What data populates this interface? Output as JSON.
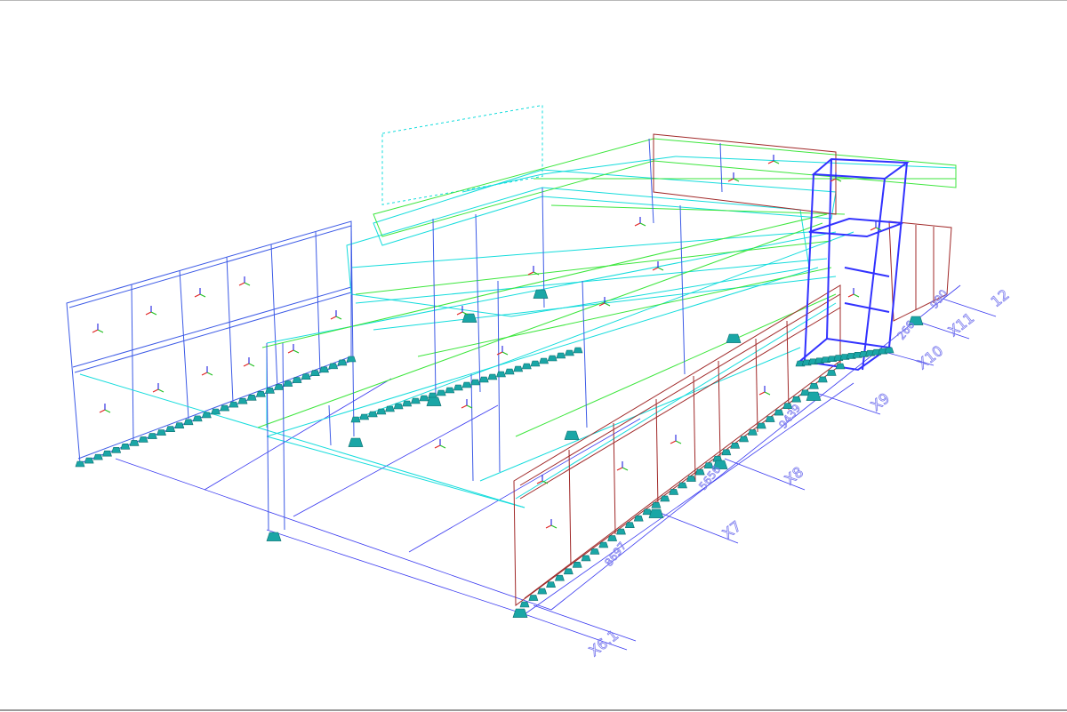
{
  "colors": {
    "grid_line": "#3a3af0",
    "grid_label": "#7a7aee",
    "dim_label": "#7a7aee",
    "wall_left": "#3c5ae6",
    "roof_cyan": "#14dcdc",
    "roof_green": "#3ce63c",
    "wall_red": "#a02828",
    "core_blue": "#3232ff",
    "support": "#1aa6a6",
    "axis_x": "#e02020",
    "axis_y": "#20c020",
    "axis_z": "#2020e0"
  },
  "grid_axes": {
    "x_labels": [
      "X6.1",
      "X7",
      "X8",
      "X9",
      "X10",
      "X11",
      "12"
    ],
    "dimensions": [
      "8697",
      "5656",
      "9439",
      "266",
      "990"
    ]
  },
  "icons": {
    "local_axes": "xyz-triad-icon",
    "support": "pinned-support-icon"
  }
}
